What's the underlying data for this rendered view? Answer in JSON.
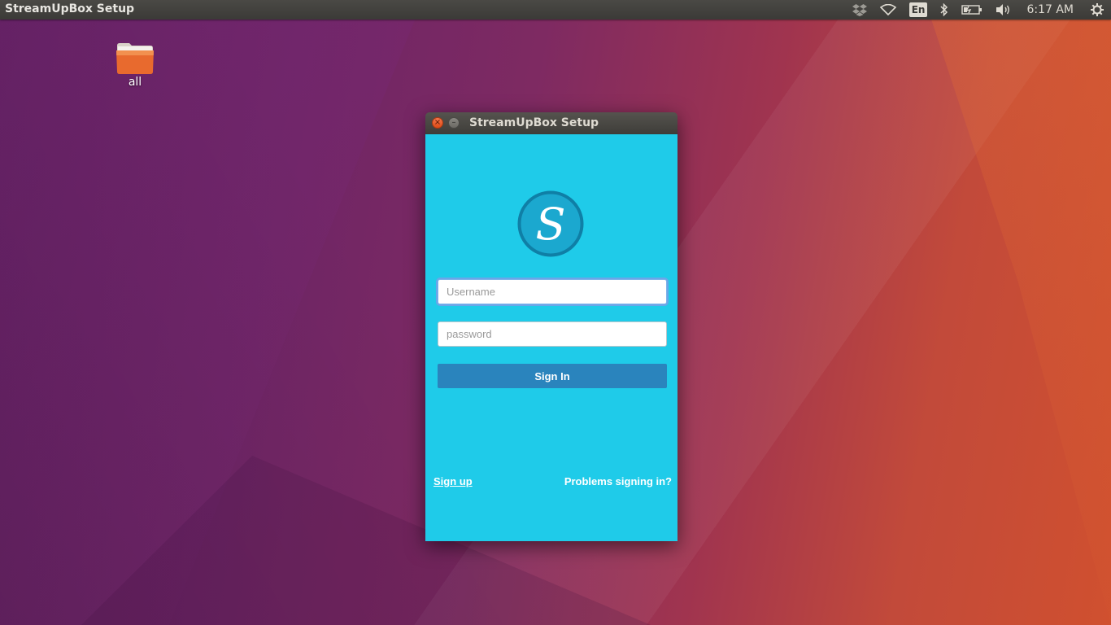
{
  "panel": {
    "app_title": "StreamUpBox Setup",
    "language": "En",
    "clock": "6:17 AM",
    "indicators": [
      "dropbox-icon",
      "wifi-icon",
      "keyboard-language",
      "bluetooth-icon",
      "battery-icon",
      "volume-icon",
      "session-gear-icon"
    ]
  },
  "desktop": {
    "icons": [
      {
        "label": "all",
        "icon": "folder-icon"
      }
    ]
  },
  "window": {
    "title": "StreamUpBox Setup",
    "close_symbol": "×",
    "minimize_symbol": "–",
    "logo_letter": "S",
    "username": {
      "placeholder": "Username",
      "value": ""
    },
    "password": {
      "placeholder": "password",
      "value": ""
    },
    "signin_label": "Sign In",
    "signup_label": "Sign up",
    "problems_label": "Problems signing in?"
  },
  "colors": {
    "window_bg": "#1fcbe9",
    "button_bg": "#2a84bd",
    "logo_ring": "#1080ab",
    "panel_bg": "#3b3a37"
  }
}
